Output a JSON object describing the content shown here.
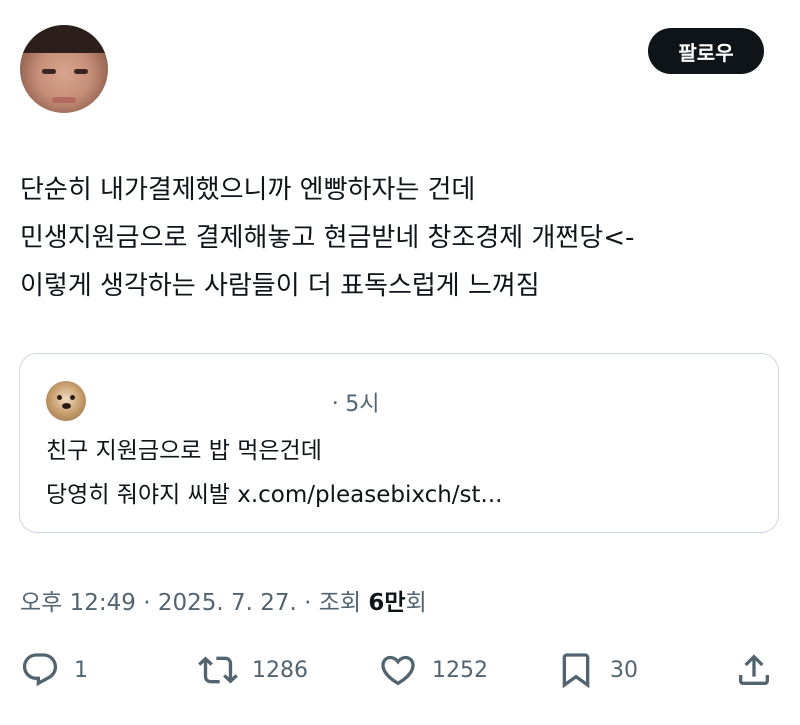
{
  "profile": {
    "follow_label": "팔로우"
  },
  "tweet": {
    "lines": [
      "단순히 내가결제했으니까 엔빵하자는 건데",
      "민생지원금으로 결제해놓고 현금받네 창조경제 개쩐당<-",
      "이렇게 생각하는 사람들이 더 표독스럽게 느껴짐"
    ]
  },
  "quote": {
    "time": "ㆍ5시",
    "lines": [
      "친구 지원금으로 밥 먹은건데",
      "당영히 줘야지 씨발 x.com/pleasebixch/st..."
    ]
  },
  "meta": {
    "prefix": "오후 12:49 · 2025. 7. 27. · 조회 ",
    "views": "6만",
    "suffix": "회"
  },
  "actions": {
    "reply_count": "1",
    "retweet_count": "1286",
    "like_count": "1252",
    "bookmark_count": "30"
  },
  "icons": [
    "reply-icon",
    "retweet-icon",
    "like-icon",
    "bookmark-icon",
    "share-icon"
  ],
  "colors": {
    "text": "#0f1419",
    "secondary": "#536471",
    "border": "#cfd9de",
    "button": "#0f1419"
  }
}
